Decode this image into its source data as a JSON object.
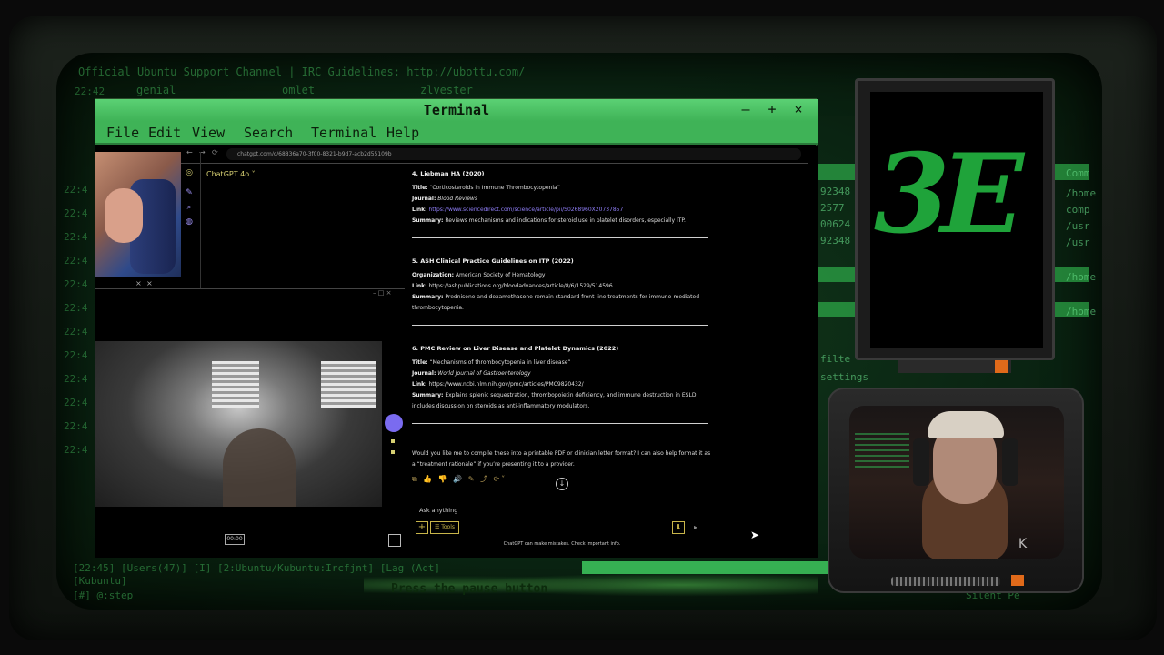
{
  "background": {
    "irc_header": "Official Ubuntu Support Channel | IRC Guidelines: http://ubottu.com/",
    "irc_names": [
      "genial",
      "omlet",
      "zlvester"
    ],
    "timestamps": [
      "22:42",
      "22:42",
      "22:4",
      "22:4",
      "22:4",
      "22:4",
      "22:4",
      "22:4",
      "22:4",
      "22:4",
      "22:4",
      "22:4",
      "22:4",
      "22:4"
    ],
    "status_line_1": "[22:45] [Users(47)] [I] [2:Ubuntu/Kubuntu:Ircfjnt] [Lag (Act]",
    "status_line_2": "[Kubuntu]",
    "status_line_3": "[#] @:step",
    "right_lines": [
      "Comm",
      "/home",
      "comp",
      "/usr",
      "/usr",
      "/home",
      "/home"
    ],
    "right_numbers": [
      "92348",
      "2577",
      "00624",
      "92348",
      "23"
    ],
    "filter_text": "filte",
    "settings_text": "settings",
    "marquee": "Press the pause button",
    "paused_text": "Silent Pe",
    "colors": {
      "accent": "#45e06a",
      "title_bar": "#5bd174"
    }
  },
  "terminal": {
    "title": "Terminal",
    "controls": {
      "minimize": "–",
      "maximize": "+",
      "close": "×"
    },
    "menu": [
      "File",
      "Edit",
      "View",
      "Search",
      "Terminal",
      "Help"
    ]
  },
  "browser": {
    "back": "←",
    "forward": "→",
    "reload": "⟳",
    "url": "chatgpt.com/c/68836a70-3f00-8321-b9d7-acb2d55109b"
  },
  "chatgpt": {
    "model": "ChatGPT 4o ˅",
    "sidebar_icons": [
      "chatgpt-icon",
      "new-chat-icon",
      "search-icon",
      "library-icon"
    ],
    "entries": [
      {
        "heading": "4. Liebman HA (2020)",
        "lines": [
          {
            "label": "Title:",
            "text": "“Corticosteroids in Immune Thrombocytopenia”"
          },
          {
            "label": "Journal:",
            "text": "Blood Reviews",
            "italic": true
          },
          {
            "label": "Link:",
            "text": "https://www.sciencedirect.com/science/article/pii/S0268960X20737857",
            "link": true
          },
          {
            "label": "Summary:",
            "text": "Reviews mechanisms and indications for steroid use in platelet disorders, especially ITP."
          }
        ]
      },
      {
        "heading": "5. ASH Clinical Practice Guidelines on ITP (2022)",
        "lines": [
          {
            "label": "Organization:",
            "text": "American Society of Hematology"
          },
          {
            "label": "Link:",
            "text": "https://ashpublications.org/bloodadvances/article/8/6/1529/514596"
          },
          {
            "label": "Summary:",
            "text": "Prednisone and dexamethasone remain standard front-line treatments for immune-mediated thrombocytopenia."
          }
        ]
      },
      {
        "heading": "6. PMC Review on Liver Disease and Platelet Dynamics (2022)",
        "lines": [
          {
            "label": "Title:",
            "text": "“Mechanisms of thrombocytopenia in liver disease”"
          },
          {
            "label": "Journal:",
            "text": "World Journal of Gastroenterology",
            "italic": true
          },
          {
            "label": "Link:",
            "text": "https://www.ncbi.nlm.nih.gov/pmc/articles/PMC9820432/"
          },
          {
            "label": "Summary:",
            "text": "Explains splenic sequestration, thrombopoietin deficiency, and immune destruction in ESLD; includes discussion on steroids as anti-inflammatory modulators."
          }
        ]
      }
    ],
    "followup": "Would you like me to compile these into a printable PDF or clinician letter format? I can also help format it as a “treatment rationale” if you’re presenting it to a provider.",
    "actions": "⧉ 👍 👎 🔊 ✎ ⤴ ⟳˅",
    "scroll_down": "↓",
    "ask_placeholder": "Ask anything",
    "plus": "+",
    "tools": "☰ Tools",
    "send": "⬇",
    "mic": "🎙",
    "disclaimer": "ChatGPT can make mistakes. Check important info."
  },
  "overlays": {
    "timer": "00:00",
    "mini_close": "×",
    "mini_controls": "– □ ×"
  },
  "logo": {
    "glyph": "3E"
  },
  "cam": {
    "logo_glyph": "K"
  }
}
